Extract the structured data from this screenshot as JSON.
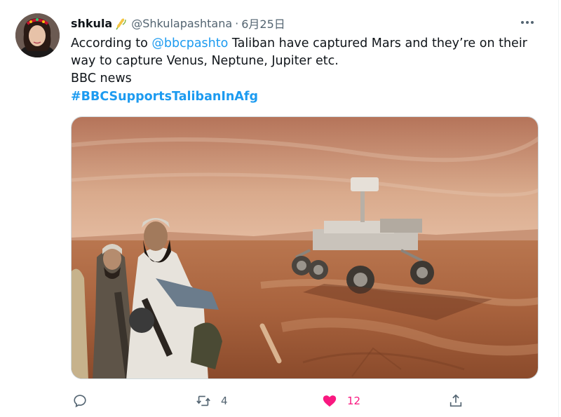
{
  "tweet": {
    "author_name": "shkula",
    "handle": "@Shkulapashtana",
    "separator": "·",
    "date": "6月25日",
    "text_before": "According to ",
    "mention": "@bbcpashto",
    "text_after": " Taliban have captured Mars and they’re on their way to capture Venus, Neptune, Jupiter etc.",
    "line2": "BBC news",
    "hashtag": "#BBCSupportsTalibanInAfg"
  },
  "actions": {
    "reply_count": "",
    "retweet_count": "4",
    "like_count": "12",
    "share_count": ""
  },
  "colors": {
    "accent": "#1d9bf0",
    "like": "#f91880",
    "muted": "#536471"
  },
  "icons": [
    "avatar",
    "wheat-emoji-badge",
    "more-icon",
    "reply-icon",
    "retweet-icon",
    "heart-icon",
    "share-icon"
  ]
}
